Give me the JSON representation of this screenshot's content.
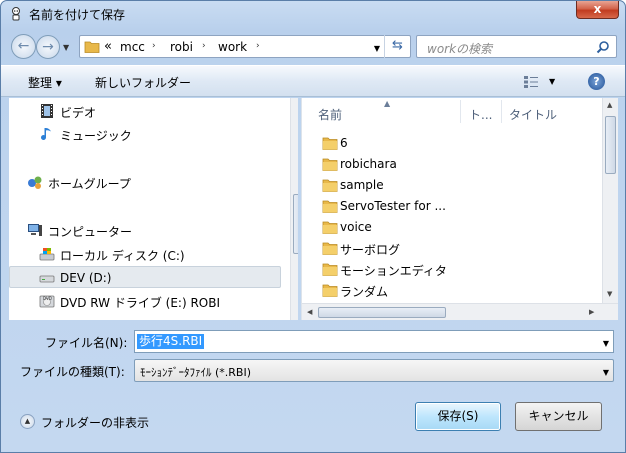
{
  "window": {
    "title": "名前を付けて保存",
    "close_glyph": "x"
  },
  "address": {
    "overflow": "«",
    "crumbs": [
      "mcc",
      "robi",
      "work"
    ],
    "separator": "›"
  },
  "search": {
    "placeholder": "workの検索"
  },
  "toolbar": {
    "organize": "整理 ▾",
    "new_folder": "新しいフォルダー"
  },
  "nav": {
    "items": [
      {
        "label": "ビデオ",
        "icon": "video-icon"
      },
      {
        "label": "ミュージック",
        "icon": "music-icon"
      },
      {
        "label": "ホームグループ",
        "icon": "homegroup-icon"
      },
      {
        "label": "コンピューター",
        "icon": "computer-icon"
      },
      {
        "label": "ローカル ディスク (C:)",
        "icon": "local-disk-icon"
      },
      {
        "label": "DEV (D:)",
        "icon": "drive-icon",
        "selected": true
      },
      {
        "label": "DVD RW ドライブ (E:) ROBI",
        "icon": "dvd-drive-icon"
      }
    ]
  },
  "columns": {
    "name": "名前",
    "type": "ト...",
    "title": "タイトル"
  },
  "files": [
    "6",
    "robichara",
    "sample",
    "ServoTester for ...",
    "voice",
    "サーボログ",
    "モーションエディタ",
    "ランダム"
  ],
  "form": {
    "filename_label": "ファイル名(N):",
    "filename_value": "歩行4S.RBI",
    "filetype_label": "ファイルの種類(T):",
    "filetype_value": "ﾓｰｼｮﾝﾃﾞｰﾀﾌｧｲﾙ (*.RBI)"
  },
  "footer": {
    "hide_folders": "フォルダーの非表示",
    "save": "保存(S)",
    "cancel": "キャンセル"
  },
  "colors": {
    "folder": "#e8b84a",
    "selection": "#3399ff",
    "accent": "#3c7fb1"
  }
}
